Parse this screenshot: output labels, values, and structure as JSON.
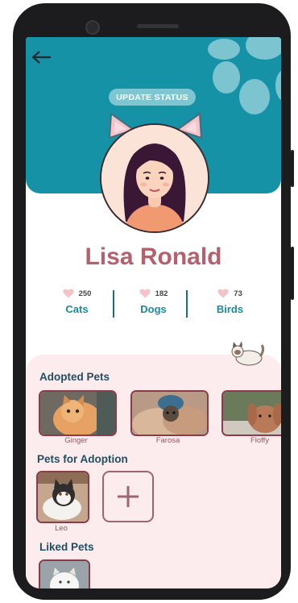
{
  "header": {
    "status_button": "UPDATE STATUS"
  },
  "profile": {
    "name": "Lisa Ronald"
  },
  "stats": [
    {
      "count": "250",
      "label": "Cats"
    },
    {
      "count": "182",
      "label": "Dogs"
    },
    {
      "count": "73",
      "label": "Birds"
    }
  ],
  "adopted": {
    "title": "Adopted Pets",
    "pets": [
      {
        "name": "Ginger"
      },
      {
        "name": "Farosa"
      },
      {
        "name": "Floffy"
      }
    ]
  },
  "for_adoption": {
    "title": "Pets for Adoption",
    "pets": [
      {
        "name": "Leo"
      }
    ]
  },
  "liked": {
    "title": "Liked Pets"
  },
  "colors": {
    "header_teal": "#1592a6",
    "name_rose": "#b5616d",
    "panel_pink": "#fcecee",
    "section_title": "#1f4e63"
  },
  "icons": [
    "back-arrow-icon",
    "heart-icon",
    "plus-icon",
    "paw-print-icon",
    "cat-icon"
  ]
}
